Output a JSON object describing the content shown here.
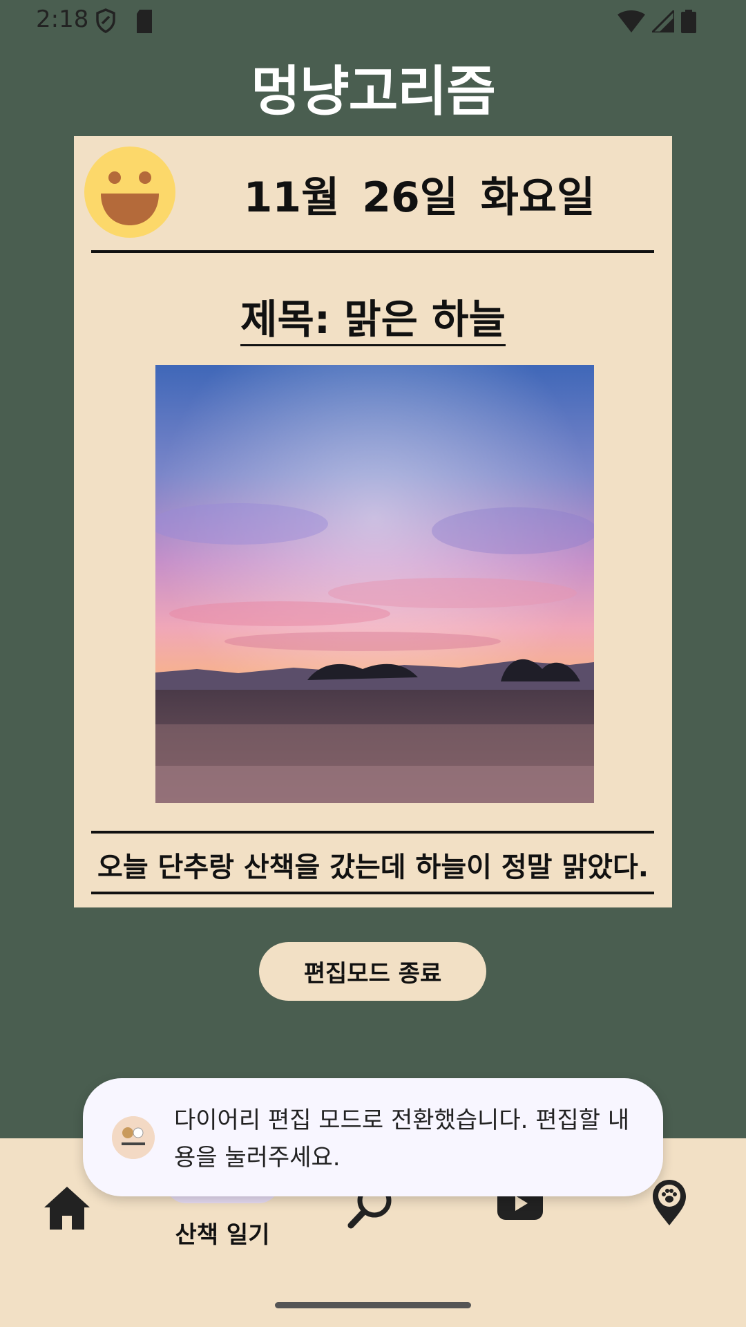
{
  "status_bar": {
    "time": "2:18"
  },
  "app": {
    "title": "멍냥고리즘"
  },
  "diary": {
    "date": "11월 26일 화요일",
    "title": "제목: 맑은 하늘",
    "content": "오늘 단추랑 산책을 갔는데 하늘이 정말 맑았다."
  },
  "edit_button": {
    "label": "편집모드 종료"
  },
  "toast": {
    "message": "다이어리 편집 모드로 전환했습니다. 편집할 내용을 눌러주세요."
  },
  "bottom_nav": {
    "items": [
      {
        "icon": "home-icon"
      },
      {
        "icon": "diary-icon",
        "label": "산책 일기",
        "selected": true
      },
      {
        "icon": "search-icon"
      },
      {
        "icon": "youtube-icon"
      },
      {
        "icon": "paw-location-icon"
      }
    ]
  },
  "colors": {
    "background": "#4a5e50",
    "card": "#f2e0c5",
    "nav_selected": "#e7dcf3",
    "toast": "#f8f6ff"
  }
}
